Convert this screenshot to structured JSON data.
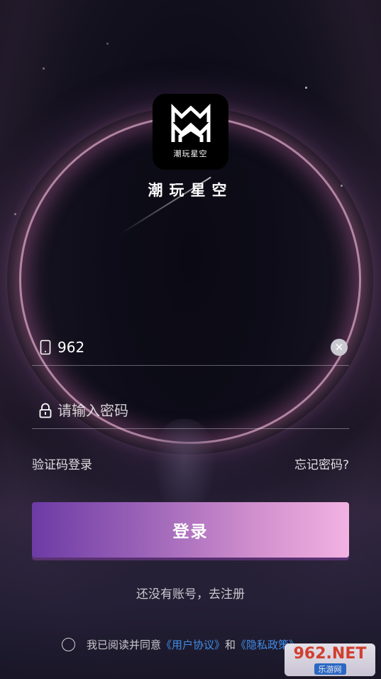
{
  "app": {
    "logo_text": "潮玩星空",
    "title": "潮玩星空"
  },
  "form": {
    "phone_value": "962",
    "password_placeholder": "请输入密码",
    "sms_login_label": "验证码登录",
    "forgot_label": "忘记密码?",
    "login_label": "登录",
    "register_label": "还没有账号，去注册"
  },
  "agreement": {
    "prefix": "我已阅读并同意",
    "user_agreement": "《用户协议》",
    "and": "和",
    "privacy_policy": "《隐私政策》"
  },
  "watermark": {
    "top": "962.NET",
    "bottom": "乐游网"
  },
  "colors": {
    "button_gradient_start": "#6c3ba5",
    "button_gradient_end": "#f2b2e2",
    "link_blue": "#3f8de8"
  }
}
